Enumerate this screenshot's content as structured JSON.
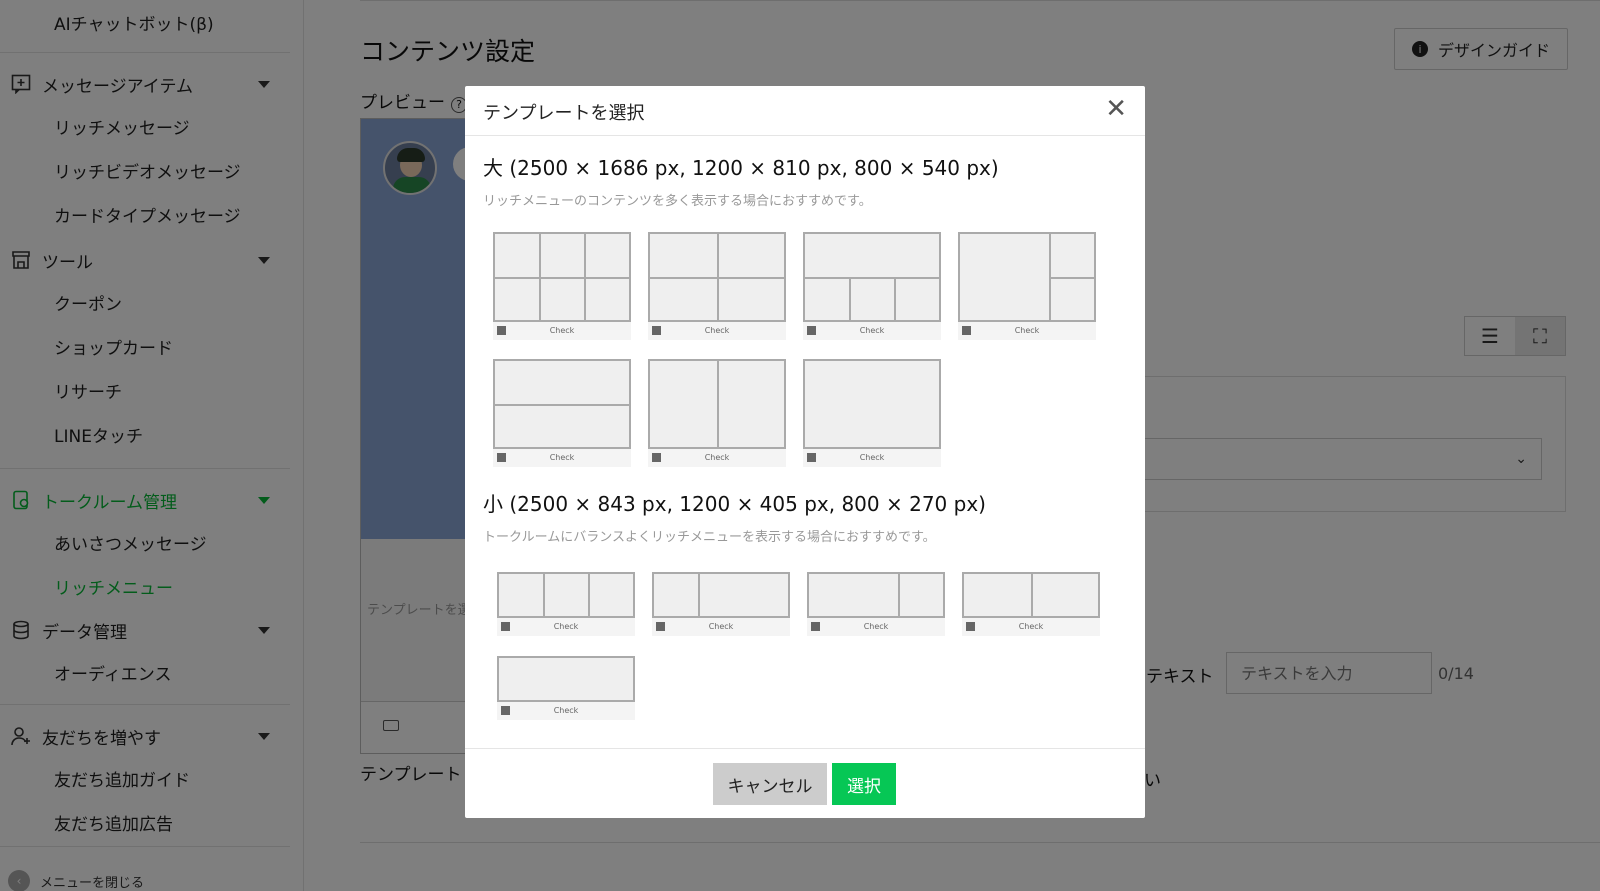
{
  "sidebar": {
    "top_item": "AIチャットボット(β)",
    "groups": [
      {
        "label": "メッセージアイテム",
        "icon": "message-plus-icon",
        "items": [
          "リッチメッセージ",
          "リッチビデオメッセージ",
          "カードタイプメッセージ"
        ]
      },
      {
        "label": "ツール",
        "icon": "store-icon",
        "items": [
          "クーポン",
          "ショップカード",
          "リサーチ",
          "LINEタッチ"
        ]
      },
      {
        "label": "トークルーム管理",
        "icon": "chat-room-icon",
        "items": [
          "あいさつメッセージ",
          "リッチメニュー"
        ]
      },
      {
        "label": "データ管理",
        "icon": "database-icon",
        "items": [
          "オーディエンス"
        ]
      },
      {
        "label": "友だちを増やす",
        "icon": "add-friend-icon",
        "items": [
          "友だち追加ガイド",
          "友だち追加広告"
        ]
      }
    ],
    "close_menu": "メニューを閉じる"
  },
  "main": {
    "title": "コンテンツ設定",
    "design_guide": "デザインガイド",
    "preview_label": "プレビュー",
    "help_icon": "?",
    "phone_template_text": "テンプレートを選",
    "template_label": "テンプレート",
    "text_label": "テキスト",
    "text_placeholder": "テキストを入力",
    "text_count": "0/14",
    "fragment": "い"
  },
  "modal": {
    "title": "テンプレートを選択",
    "large_heading": "大 (2500 × 1686 px, 1200 × 810 px, 800 × 540 px)",
    "large_note": "リッチメニューのコンテンツを多く表示する場合におすすめです。",
    "small_heading": "小 (2500 × 843 px, 1200 × 405 px, 800 × 270 px)",
    "small_note": "トークルームにバランスよくリッチメニューを表示する場合におすすめです。",
    "check_label": "Check",
    "cancel_label": "キャンセル",
    "select_label": "選択"
  },
  "colors": {
    "line_green": "#06c755",
    "active_green": "#06b836",
    "overlay": "rgba(0,0,0,0.5)"
  }
}
